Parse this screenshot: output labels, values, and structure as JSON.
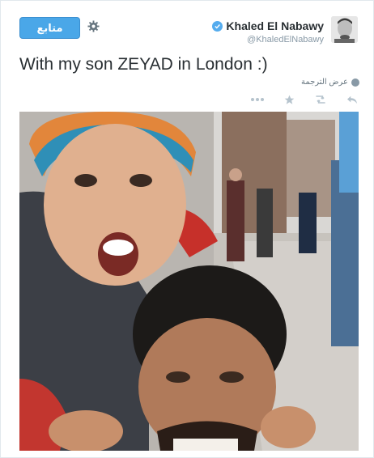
{
  "tweet": {
    "follow_label": "متابع",
    "display_name": "Khaled El Nabawy",
    "handle": "@KhaledElNabawy",
    "text": "With my son ZEYAD in London :)",
    "translate_label": "عرض الترجمة"
  },
  "icons": {
    "settings": "gear-icon",
    "verified": "verified-badge-icon",
    "globe": "globe-icon",
    "more": "more-icon",
    "favorite": "star-icon",
    "retweet": "retweet-icon",
    "reply": "reply-icon"
  },
  "colors": {
    "accent": "#55acee",
    "button": "#4aa7e8",
    "text": "#292f33",
    "muted": "#8899a6"
  }
}
